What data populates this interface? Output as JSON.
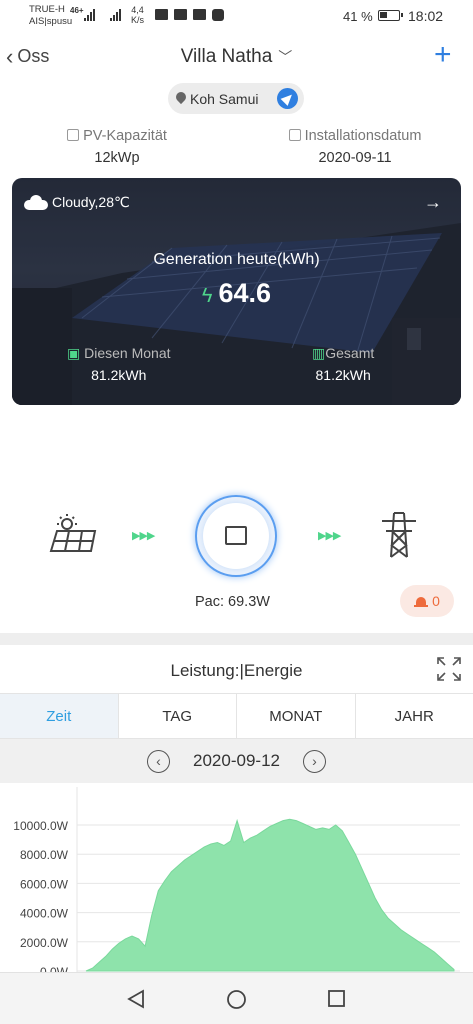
{
  "status_bar": {
    "carrier_line1": "TRUE-H",
    "carrier_line2": "AIS|spusu",
    "network_type": "46+",
    "speed_value": "4,4",
    "speed_unit": "K/s",
    "battery_percent": "41 %",
    "time": "18:02"
  },
  "header": {
    "back_label": "Oss",
    "title": "Villa Natha",
    "location": "Koh Samui"
  },
  "plant_info": {
    "capacity_label": "PV-Kapazität",
    "capacity_value": "12kWp",
    "install_label": "Installationsdatum",
    "install_value": "2020-09-11"
  },
  "hero": {
    "weather": "Cloudy,28℃",
    "generation_label": "Generation heute(kWh)",
    "generation_value": "64.6",
    "month_label": "Diesen Monat",
    "month_value": "81.2kWh",
    "total_label": "Gesamt",
    "total_value": "81.2kWh"
  },
  "flow": {
    "pac_label": "Pac:",
    "pac_value": "69.3W",
    "alarm_count": "0"
  },
  "chart_section": {
    "title": "Leistung:|Energie",
    "tabs": [
      "Zeit",
      "TAG",
      "MONAT",
      "JAHR"
    ],
    "active_tab": "Zeit",
    "date": "2020-09-12"
  },
  "colors": {
    "accent": "#2f7fe0",
    "tab_active": "#2f9ee0",
    "area_fill": "#8ee3ab",
    "alarm": "#ee6b3c",
    "flow_dots": "#4fd58b"
  },
  "icons": [
    "back-chevron-icon",
    "dropdown-chevron-icon",
    "plus-icon",
    "location-pin-icon",
    "navigate-icon",
    "cloud-icon",
    "arrow-right-icon",
    "bolt-icon",
    "calendar-icon",
    "chart-icon",
    "solar-panel-icon",
    "inverter-icon",
    "power-tower-icon",
    "siren-icon",
    "expand-icon",
    "prev-date-icon",
    "next-date-icon"
  ],
  "chart_data": {
    "type": "area",
    "y_ticks": [
      "10000.0W",
      "8000.0W",
      "6000.0W",
      "4000.0W",
      "2000.0W",
      "0.0W"
    ],
    "ylim": [
      0,
      11800
    ],
    "grid": true,
    "series": [
      {
        "values": [
          0,
          200,
          600,
          1000,
          1500,
          1900,
          2200,
          2400,
          2200,
          1700,
          3800,
          5500,
          6200,
          6800,
          7200,
          7600,
          7900,
          8200,
          8500,
          8700,
          8800,
          8600,
          8900,
          10300,
          8800,
          9100,
          9300,
          9600,
          9900,
          10100,
          10300,
          10400,
          10300,
          10100,
          9900,
          9700,
          9800,
          9700,
          10000,
          9600,
          8800,
          8000,
          7000,
          6000,
          5000,
          4200,
          3600,
          3200,
          2800,
          2500,
          2200,
          1900,
          1600,
          1300,
          900,
          500,
          100
        ]
      }
    ]
  }
}
